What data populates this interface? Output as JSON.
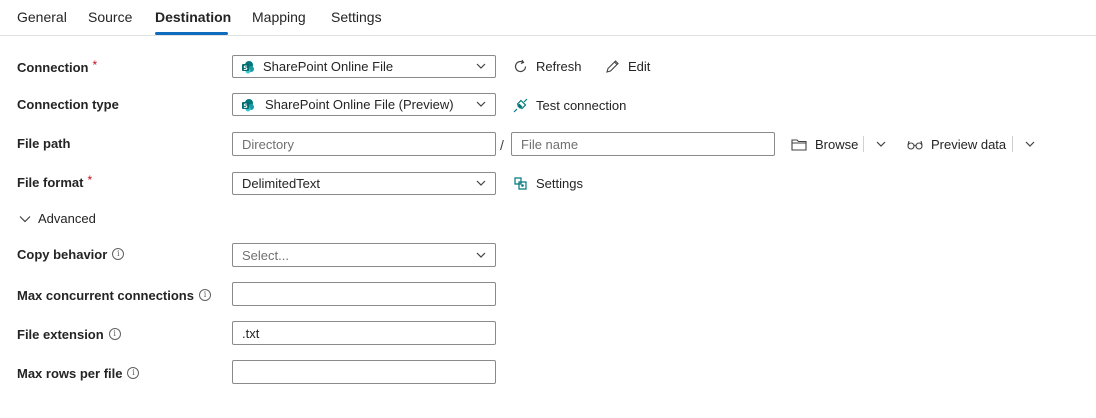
{
  "tabs": {
    "general": "General",
    "source": "Source",
    "destination": "Destination",
    "mapping": "Mapping",
    "settings": "Settings"
  },
  "connection": {
    "label": "Connection",
    "required": "*",
    "value": "SharePoint Online File",
    "refresh": "Refresh",
    "edit": "Edit"
  },
  "connection_type": {
    "label": "Connection type",
    "value": "SharePoint Online File (Preview)",
    "test": "Test connection"
  },
  "file_path": {
    "label": "File path",
    "directory_placeholder": "Directory",
    "separator": "/",
    "filename_placeholder": "File name",
    "browse": "Browse",
    "preview": "Preview data"
  },
  "file_format": {
    "label": "File format",
    "required": "*",
    "value": "DelimitedText",
    "settings": "Settings"
  },
  "advanced": {
    "label": "Advanced"
  },
  "copy_behavior": {
    "label": "Copy behavior",
    "placeholder": "Select..."
  },
  "max_concurrent": {
    "label": "Max concurrent connections",
    "value": ""
  },
  "file_extension": {
    "label": "File extension",
    "value": ".txt"
  },
  "max_rows": {
    "label": "Max rows per file",
    "value": ""
  },
  "colors": {
    "accent": "#0f6cbd",
    "sharepoint": "#03787c",
    "required": "#c50f1f"
  }
}
